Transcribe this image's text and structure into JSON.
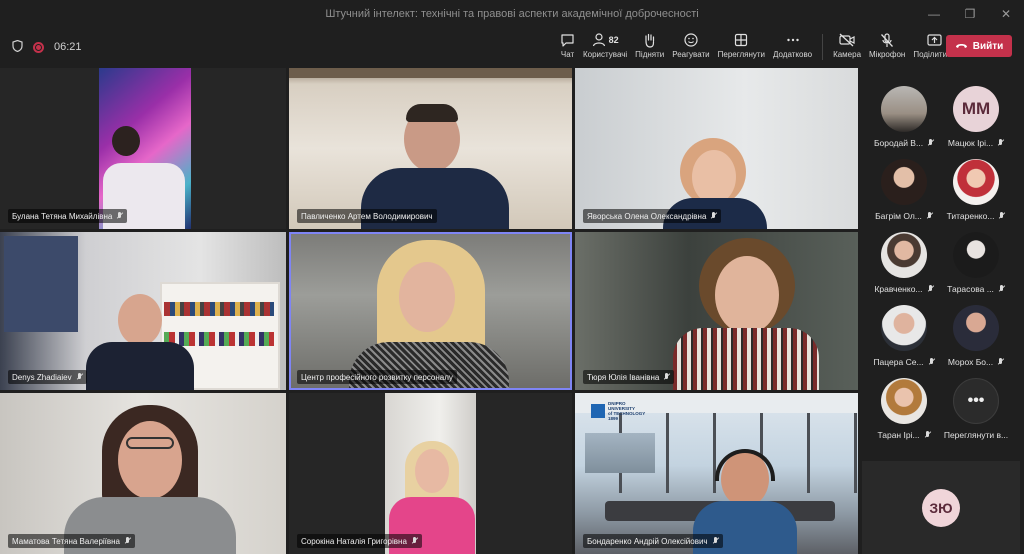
{
  "window": {
    "title": "Штучний інтелект: технічні та правові аспекти академічної доброчесності"
  },
  "toolbar": {
    "timer": "06:21",
    "participants_count": "82",
    "buttons": [
      {
        "label": "Чат",
        "icon": "chat-icon"
      },
      {
        "label": "Користувачі",
        "icon": "people-icon"
      },
      {
        "label": "Підняти",
        "icon": "hand-icon"
      },
      {
        "label": "Реагувати",
        "icon": "smile-icon"
      },
      {
        "label": "Переглянути",
        "icon": "view-icon"
      },
      {
        "label": "Додатково",
        "icon": "more-icon"
      },
      {
        "label": "Камера",
        "icon": "camera-off-icon"
      },
      {
        "label": "Мікрофон",
        "icon": "mic-off-icon"
      },
      {
        "label": "Поділитися",
        "icon": "share-icon"
      }
    ],
    "leave_label": "Вийти",
    "accent": "#c4314b"
  },
  "tiles": [
    {
      "name": "Булана Тетяна Михайлівна"
    },
    {
      "name": "Павличенко Артем Володимирович"
    },
    {
      "name": "Яворська Олена Олександрівна"
    },
    {
      "name": "Denys Zhadiaiev"
    },
    {
      "name": "Центр професійного розвитку персоналу"
    },
    {
      "name": "Тюря Юлія Іванівна"
    },
    {
      "name": "Маматова Тетяна Валеріївна"
    },
    {
      "name": "Сорокіна Наталія Григорівна"
    },
    {
      "name": "Бондаренко Андрій Олексійович"
    }
  ],
  "background_logo": {
    "line1": "DNIPRO",
    "line2": "UNIVERSITY",
    "line3": "of TECHNOLOGY",
    "line4": "1899"
  },
  "sidebar": {
    "participants": [
      {
        "name": "Бородай В...",
        "initials": ""
      },
      {
        "name": "Мацюк Ірі...",
        "initials": "MM"
      },
      {
        "name": "Багрім Ол...",
        "initials": ""
      },
      {
        "name": "Титаренко...",
        "initials": ""
      },
      {
        "name": "Кравченко...",
        "initials": ""
      },
      {
        "name": "Тарасова ...",
        "initials": ""
      },
      {
        "name": "Пацера Се...",
        "initials": ""
      },
      {
        "name": "Морох Бо...",
        "initials": ""
      },
      {
        "name": "Таран Ірі...",
        "initials": ""
      }
    ],
    "more_label": "Переглянути в...",
    "more_glyph": "•••",
    "self_initials": "ЗЮ"
  }
}
